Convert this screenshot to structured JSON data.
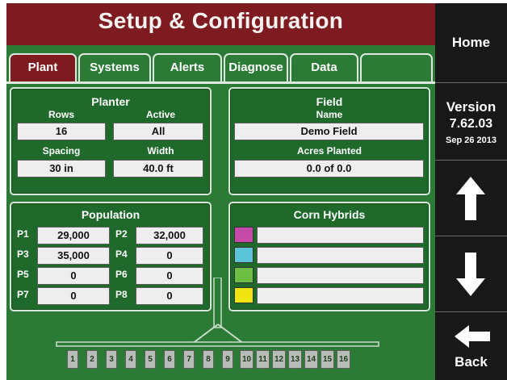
{
  "header": {
    "title": "Setup & Configuration"
  },
  "tabs": [
    {
      "label": "Plant",
      "active": true
    },
    {
      "label": "Systems",
      "active": false
    },
    {
      "label": "Alerts",
      "active": false
    },
    {
      "label": "Diagnose",
      "active": false
    },
    {
      "label": "Data",
      "active": false
    },
    {
      "label": "",
      "active": false
    }
  ],
  "planter": {
    "title": "Planter",
    "rows_label": "Rows",
    "rows_value": "16",
    "active_label": "Active",
    "active_value": "All",
    "spacing_label": "Spacing",
    "spacing_value": "30 in",
    "width_label": "Width",
    "width_value": "40.0 ft"
  },
  "field": {
    "title": "Field",
    "name_label": "Name",
    "name_value": "Demo Field",
    "acres_label": "Acres Planted",
    "acres_value": "0.0  of  0.0"
  },
  "population": {
    "title": "Population",
    "items": [
      {
        "label": "P1",
        "value": "29,000"
      },
      {
        "label": "P2",
        "value": "32,000"
      },
      {
        "label": "P3",
        "value": "35,000"
      },
      {
        "label": "P4",
        "value": "0"
      },
      {
        "label": "P5",
        "value": "0"
      },
      {
        "label": "P6",
        "value": "0"
      },
      {
        "label": "P7",
        "value": "0"
      },
      {
        "label": "P8",
        "value": "0"
      }
    ]
  },
  "hybrids": {
    "title": "Corn Hybrids",
    "colors": [
      "#c64aa8",
      "#5dc4d8",
      "#6cbe45",
      "#f0e312"
    ]
  },
  "planter_rows": [
    "1",
    "2",
    "3",
    "4",
    "5",
    "6",
    "7",
    "8",
    "9",
    "10",
    "11",
    "12",
    "13",
    "14",
    "15",
    "16"
  ],
  "sidebar": {
    "home": "Home",
    "version_title": "Version",
    "version_number": "7.62.03",
    "version_date": "Sep 26 2013",
    "back": "Back"
  },
  "colors": {
    "header": "#7d1b20",
    "panel_green": "#2b7a36",
    "sidebar": "#111111"
  }
}
